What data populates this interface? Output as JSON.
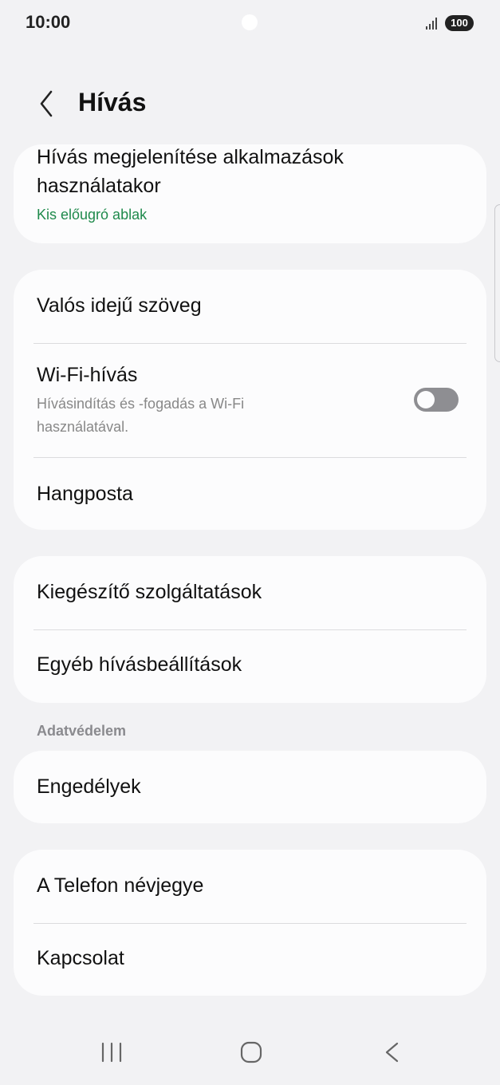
{
  "status": {
    "time": "10:00",
    "battery": "100",
    "signal_icon": "signal-icon"
  },
  "header": {
    "title": "Hívás",
    "back_icon": "chevron-left-icon"
  },
  "cards": {
    "display": {
      "title_line1": "Hívás megjelenítése alkalmazások",
      "title_line2": "használatakor",
      "subtitle": "Kis előugró ablak"
    },
    "rtt": {
      "title": "Valós idejű szöveg"
    },
    "wifi": {
      "title": "Wi-Fi-hívás",
      "subtitle_line1": "Hívásindítás és -fogadás a Wi-Fi",
      "subtitle_line2": "használatával.",
      "enabled": false
    },
    "voicemail": {
      "title": "Hangposta"
    },
    "supplementary": {
      "title": "Kiegészítő szolgáltatások"
    },
    "other": {
      "title": "Egyéb hívásbeállítások"
    },
    "privacy_section": "Adatvédelem",
    "permissions": {
      "title": "Engedélyek"
    },
    "about": {
      "title": "A Telefon névjegye"
    },
    "contact": {
      "title": "Kapcsolat"
    }
  },
  "colors": {
    "background": "#f2f2f4",
    "card": "#fcfcfd",
    "accent_green": "#1f8a4c",
    "toggle_off": "#8e8e92"
  },
  "nav": {
    "recents_icon": "recents-icon",
    "home_icon": "home-icon",
    "back_icon": "back-icon"
  }
}
